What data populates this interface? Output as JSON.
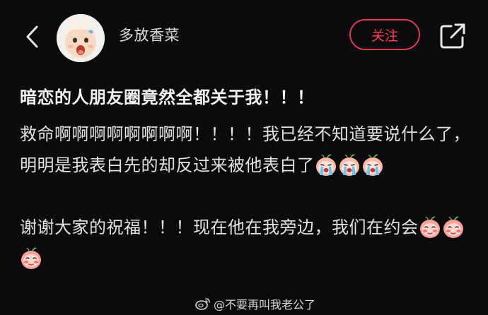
{
  "header": {
    "username": "多放香菜",
    "follow_label": "关注",
    "back_icon": "chevron-left-icon",
    "share_icon": "share-external-icon"
  },
  "post": {
    "title": "暗恋的人朋友圈竟然全都关于我！！！",
    "para1_text": "救命啊啊啊啊啊啊啊啊！！！！我已经不知道要说什么了，明明是我表白先的却反过来被他表白了",
    "para1_emoji": "crying-peach-emoji",
    "para2_text": "谢谢大家的祝福！！！现在他在我旁边，我们在约会",
    "para2_emoji": "shy-peach-emoji"
  },
  "watermark": {
    "text": "@不要再叫我老公了",
    "icon": "weibo-icon"
  },
  "colors": {
    "background": "#0b0b0d",
    "follow_accent": "#ff3c55"
  }
}
